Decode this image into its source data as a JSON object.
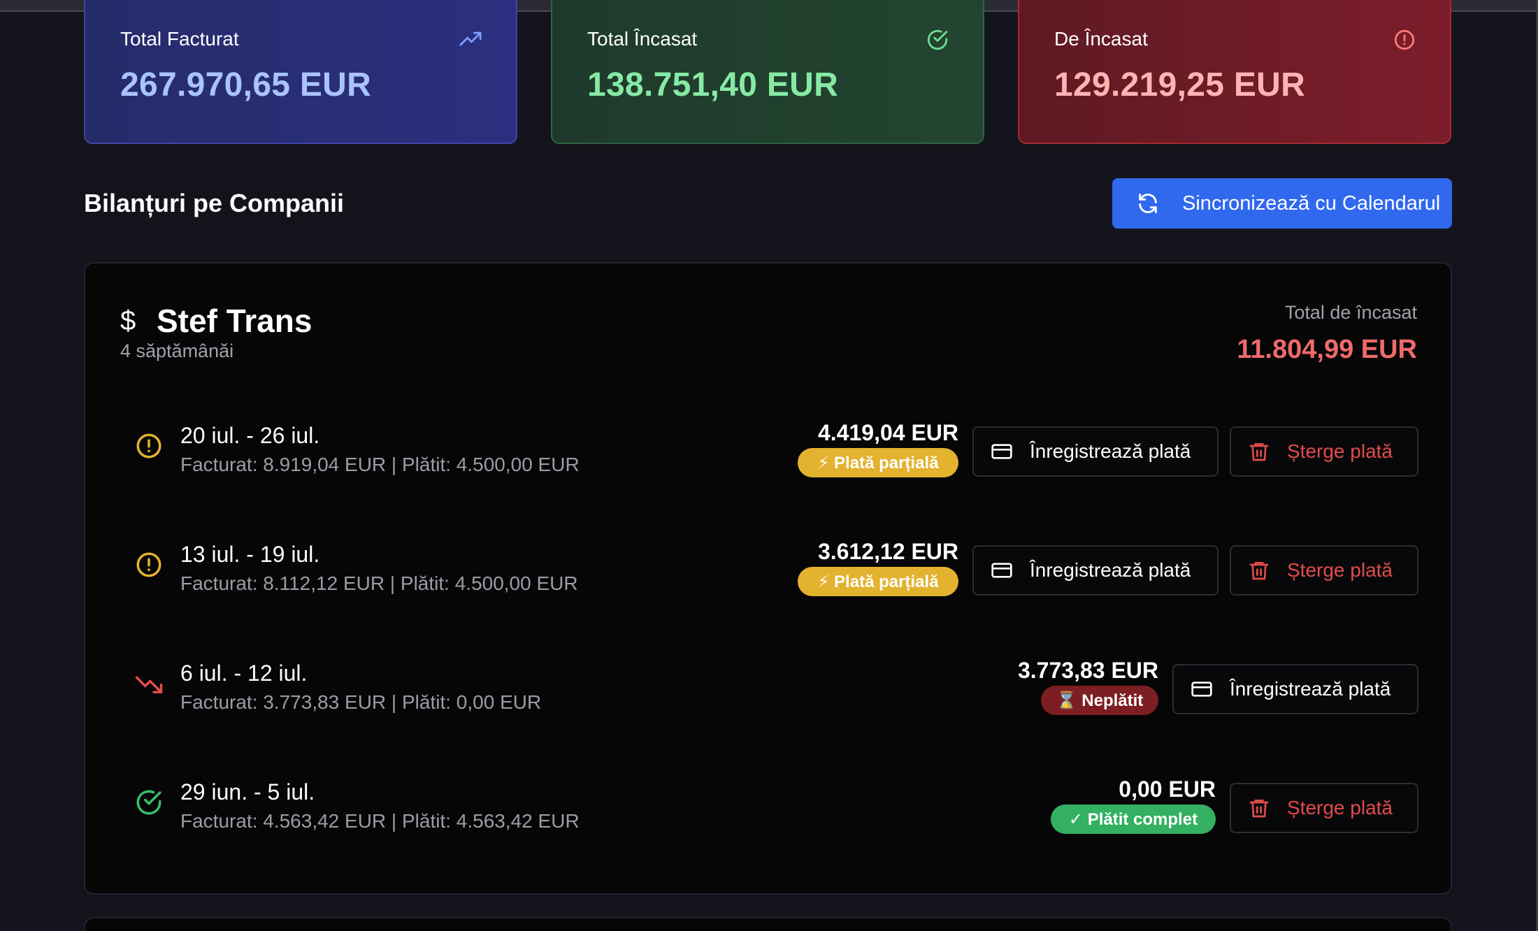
{
  "stats": {
    "invoiced": {
      "label": "Total Facturat",
      "value": "267.970,65 EUR",
      "icon": "trending-up-icon"
    },
    "collected": {
      "label": "Total Încasat",
      "value": "138.751,40 EUR",
      "icon": "check-circle-icon"
    },
    "due": {
      "label": "De Încasat",
      "value": "129.219,25 EUR",
      "icon": "alert-circle-icon"
    }
  },
  "section": {
    "title": "Bilanțuri pe Companii",
    "sync_label": "Sincronizează cu Calendarul"
  },
  "company": {
    "icon": "$",
    "name": "Stef Trans",
    "subtitle": "4 săptămânăi",
    "due_label": "Total de încasat",
    "due_value": "11.804,99 EUR"
  },
  "weeks": [
    {
      "period": "20 iul. - 26 iul.",
      "detail": "Facturat: 8.919,04 EUR | Plătit: 4.500,00 EUR",
      "amount": "4.419,04 EUR",
      "badge": "⚡ Plată parțială",
      "status": "partial",
      "pay_label": "Înregistrează plată",
      "delete_label": "Șterge plată"
    },
    {
      "period": "13 iul. - 19 iul.",
      "detail": "Facturat: 8.112,12 EUR | Plătit: 4.500,00 EUR",
      "amount": "3.612,12 EUR",
      "badge": "⚡ Plată parțială",
      "status": "partial",
      "pay_label": "Înregistrează plată",
      "delete_label": "Șterge plată"
    },
    {
      "period": "6 iul. - 12 iul.",
      "detail": "Facturat: 3.773,83 EUR | Plătit: 0,00 EUR",
      "amount": "3.773,83 EUR",
      "badge": "⌛ Neplătit",
      "status": "unpaid",
      "pay_label": "Înregistrează plată"
    },
    {
      "period": "29 iun. - 5 iul.",
      "detail": "Facturat: 4.563,42 EUR | Plătit: 4.563,42 EUR",
      "amount": "0,00 EUR",
      "badge": "✓ Plătit complet",
      "status": "paid",
      "delete_label": "Șterge plată"
    }
  ],
  "colors": {
    "accent_blue": "#3169ee",
    "partial": "#e3b22f",
    "unpaid": "#7d1f22",
    "paid": "#33b061",
    "due_red": "#f06a6a"
  }
}
